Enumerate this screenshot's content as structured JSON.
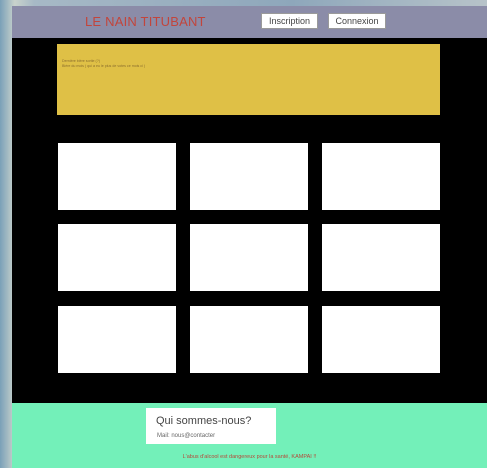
{
  "header": {
    "brand": "LE NAIN TITUBANT",
    "signup_label": "Inscription",
    "login_label": "Connexion"
  },
  "banner": {
    "line1": "Dernière bière sortie (?)",
    "line2": "Bière du mois ( qui a eu le plus de votes ce mois ci )"
  },
  "footer": {
    "about_title": "Qui sommes-nous?",
    "about_mail": "Mail: nous@contacter",
    "disclaimer": "L'abus d'alcool est dangereux pour la santé, KAMPAI !!"
  }
}
